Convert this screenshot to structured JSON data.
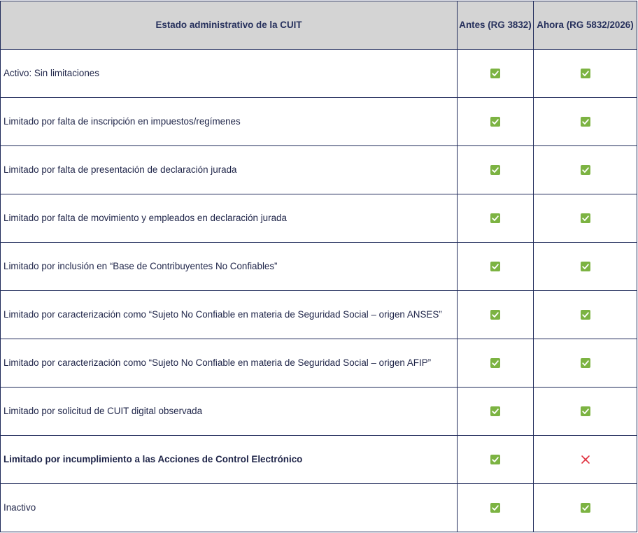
{
  "colors": {
    "header_bg": "#d4d4d4",
    "border": "#1f2a5a",
    "check_green": "#7cb342",
    "cross_red": "#e0313f"
  },
  "table": {
    "headers": [
      "Estado administrativo de la CUIT",
      "Antes (RG 3832)",
      "Ahora (RG 5832/2026)"
    ],
    "rows": [
      {
        "label": "Activo: Sin limitaciones",
        "bold": false,
        "antes": "check",
        "ahora": "check"
      },
      {
        "label": "Limitado por falta de inscripción en impuestos/regímenes",
        "bold": false,
        "antes": "check",
        "ahora": "check"
      },
      {
        "label": "Limitado por falta de presentación de declaración jurada",
        "bold": false,
        "antes": "check",
        "ahora": "check"
      },
      {
        "label": "Limitado por falta de movimiento y empleados en declaración jurada",
        "bold": false,
        "antes": "check",
        "ahora": "check"
      },
      {
        "label": "Limitado por inclusión en “Base de Contribuyentes No Confiables”",
        "bold": false,
        "antes": "check",
        "ahora": "check"
      },
      {
        "label": "Limitado por caracterización como “Sujeto No Confiable en materia de Seguridad Social – origen ANSES”",
        "bold": false,
        "antes": "check",
        "ahora": "check"
      },
      {
        "label": "Limitado por caracterización como “Sujeto No Confiable en materia de Seguridad Social – origen AFIP”",
        "bold": false,
        "antes": "check",
        "ahora": "check"
      },
      {
        "label": "Limitado por solicitud de CUIT digital observada",
        "bold": false,
        "antes": "check",
        "ahora": "check"
      },
      {
        "label": "Limitado por incumplimiento a las Acciones de Control Electrónico",
        "bold": true,
        "antes": "check",
        "ahora": "cross"
      },
      {
        "label": "Inactivo",
        "bold": false,
        "antes": "check",
        "ahora": "check"
      }
    ]
  }
}
